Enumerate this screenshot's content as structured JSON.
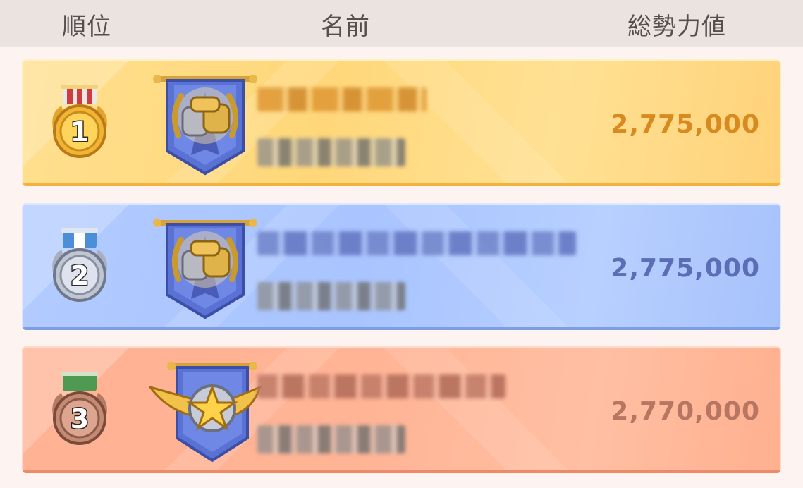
{
  "header": {
    "rank_label": "順位",
    "name_label": "名前",
    "power_label": "総勢力値"
  },
  "rows": [
    {
      "rank": "1",
      "medal": "gold-medal-icon",
      "emblem": "fist-bump-emblem-icon",
      "power": "2,775,000",
      "accent": "#d98a1e"
    },
    {
      "rank": "2",
      "medal": "silver-medal-icon",
      "emblem": "fist-bump-emblem-icon",
      "power": "2,775,000",
      "accent": "#5b6db5"
    },
    {
      "rank": "3",
      "medal": "bronze-medal-icon",
      "emblem": "winged-star-emblem-icon",
      "power": "2,770,000",
      "accent": "#b77662"
    }
  ]
}
